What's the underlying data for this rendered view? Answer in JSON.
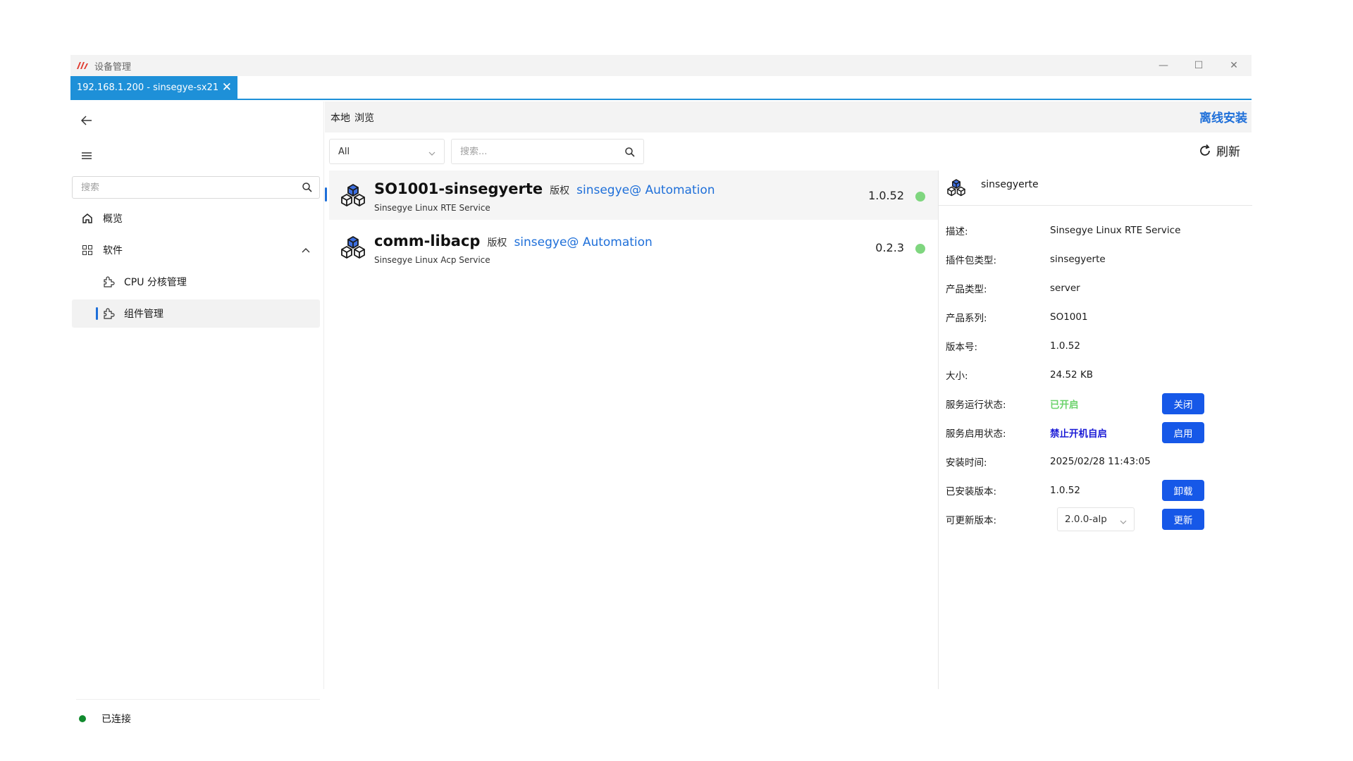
{
  "window": {
    "title": "设备管理",
    "controls": {
      "minimize": "—",
      "maximize": "☐",
      "close": "✕"
    }
  },
  "connection_tab": {
    "label": "192.168.1.200 - sinsegye-sx21",
    "close": "✕"
  },
  "sidebar": {
    "search_placeholder": "搜索",
    "items": [
      {
        "label": "概览",
        "icon": "home-icon"
      },
      {
        "label": "软件",
        "icon": "grid-icon",
        "expanded": true
      },
      {
        "label": "CPU 分核管理",
        "icon": "puzzle-icon"
      },
      {
        "label": "组件管理",
        "icon": "puzzle-icon",
        "active": true
      }
    ],
    "status": {
      "label": "已连接",
      "color": "#118a2e"
    }
  },
  "main": {
    "tabs": [
      {
        "label": "本地",
        "active": true
      },
      {
        "label": "浏览"
      }
    ],
    "offline_install": "离线安装",
    "filter": {
      "selected": "All"
    },
    "search_placeholder": "搜索...",
    "refresh": "刷新"
  },
  "packages": [
    {
      "name": "SO1001-sinsegyerte",
      "copyright": "版权",
      "vendor": "sinsegye@ Automation",
      "description": "Sinsegye Linux RTE Service",
      "version": "1.0.52",
      "status_color": "#7fd67f",
      "selected": true
    },
    {
      "name": "comm-libacp",
      "copyright": "版权",
      "vendor": "sinsegye@ Automation",
      "description": "Sinsegye Linux Acp Service",
      "version": "0.2.3",
      "status_color": "#7fd67f",
      "selected": false
    }
  ],
  "detail": {
    "title": "sinsegyerte",
    "rows": {
      "desc": {
        "label": "描述:",
        "value": "Sinsegye Linux RTE Service"
      },
      "pkg_type": {
        "label": "插件包类型:",
        "value": "sinsegyerte"
      },
      "product_type": {
        "label": "产品类型:",
        "value": "server"
      },
      "product_series": {
        "label": "产品系列:",
        "value": "SO1001"
      },
      "version": {
        "label": "版本号:",
        "value": "1.0.52"
      },
      "size": {
        "label": "大小:",
        "value": "24.52 KB"
      },
      "run_state": {
        "label": "服务运行状态:",
        "value": "已开启",
        "button": "关闭"
      },
      "enable_state": {
        "label": "服务启用状态:",
        "value": "禁止开机自启",
        "button": "启用"
      },
      "install_time": {
        "label": "安装时间:",
        "value": "2025/02/28 11:43:05"
      },
      "installed_version": {
        "label": "已安装版本:",
        "value": "1.0.52",
        "button": "卸载"
      },
      "update_version": {
        "label": "可更新版本:",
        "value": "2.0.0-alp",
        "button": "更新"
      }
    }
  },
  "colors": {
    "accent": "#1e90d8",
    "link": "#1e6fd9",
    "button": "#1658e8",
    "running": "#6cd36c",
    "disabled_text": "#1b1bd6"
  }
}
